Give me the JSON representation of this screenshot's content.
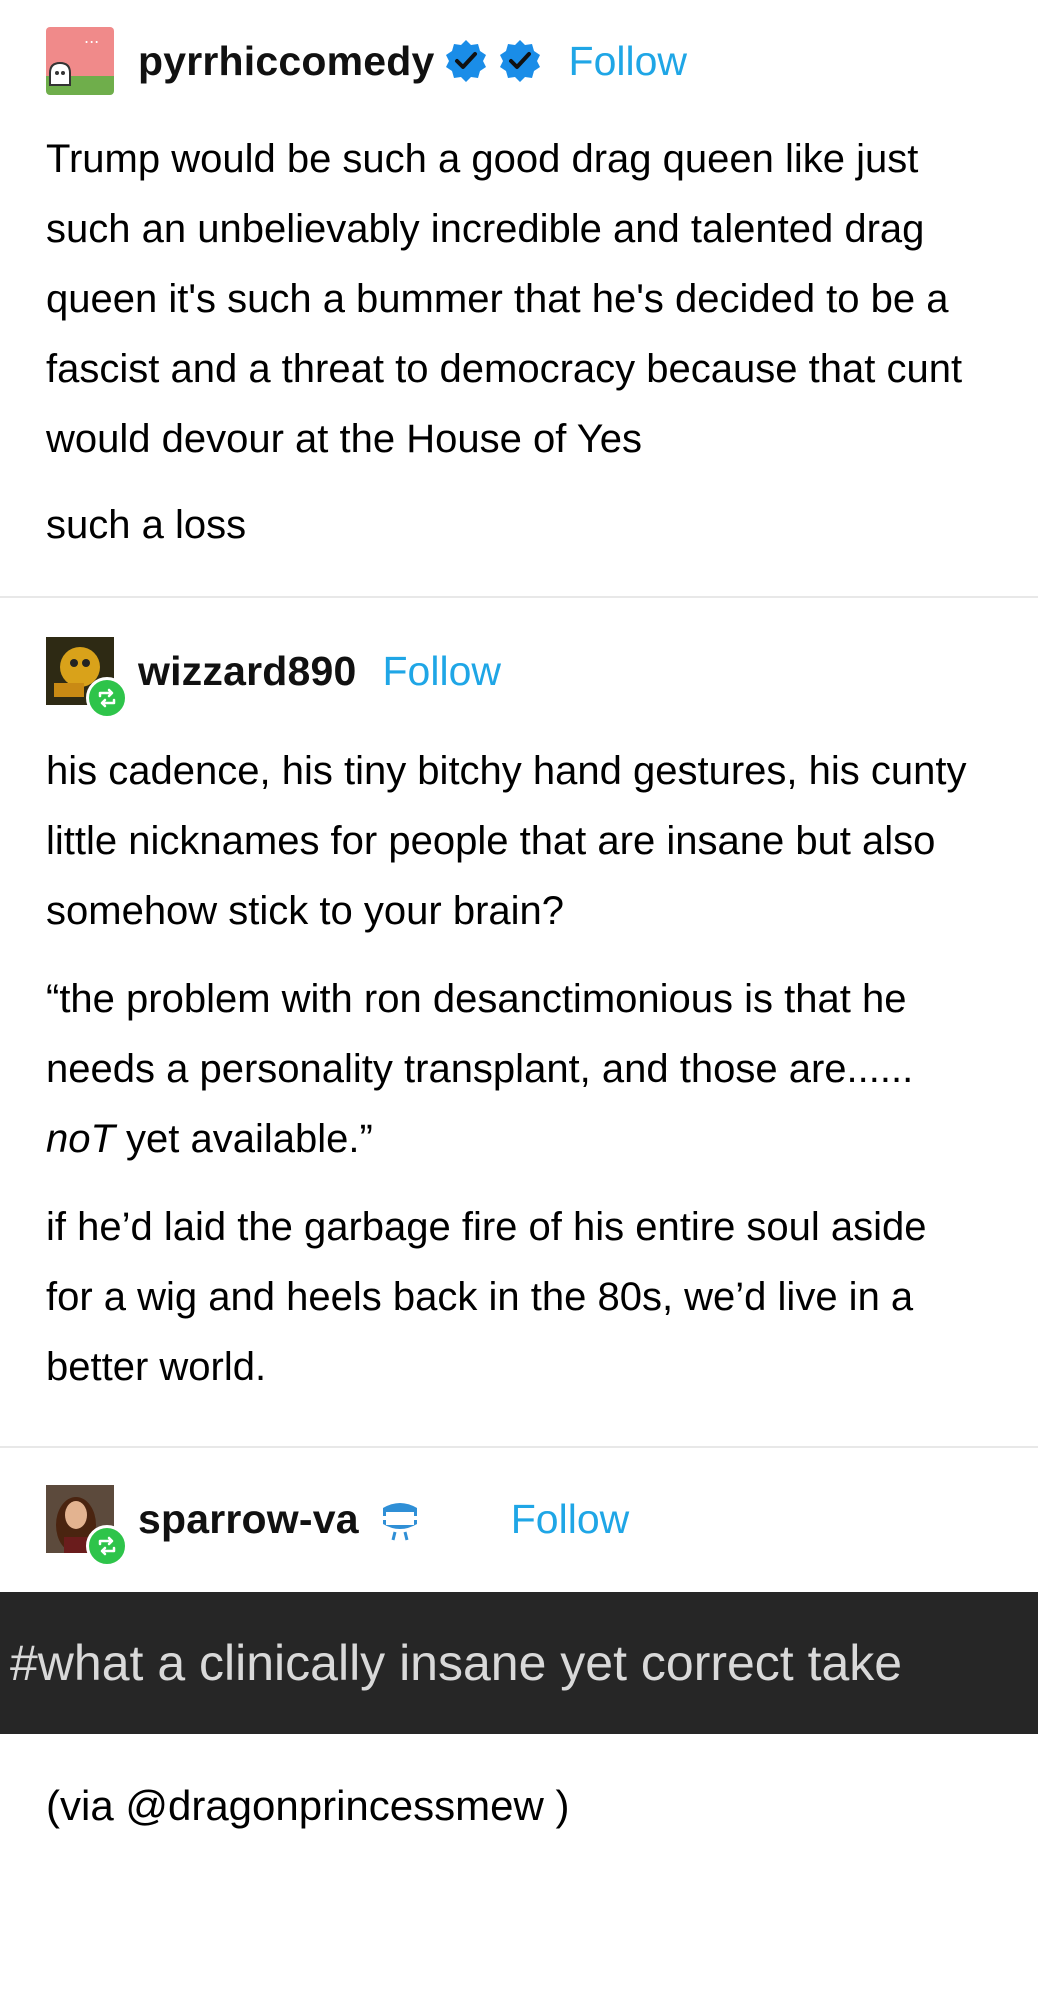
{
  "posts": [
    {
      "username": "pyrrhiccomedy",
      "follow": "Follow",
      "paragraphs": [
        "Trump would be such a good drag queen like just such an unbelievably incredible and talented drag queen it's such a bummer that he's decided to be a fascist and a threat to democracy because that cunt would devour at the House of Yes",
        "such a loss"
      ]
    },
    {
      "username": "wizzard890",
      "follow": "Follow",
      "p1": "his cadence, his tiny bitchy hand gestures, his cunty little nicknames for people that are insane but also somehow stick to your brain?",
      "p2_start": "“the problem with ron desanctimonious is that he needs a personality transplant, and those are...... ",
      "p2_em": "noT",
      "p2_end": " yet available.”",
      "p3": "if he’d laid the garbage fire of his entire soul aside for a wig and heels back in the 80s, we’d live in a better world."
    },
    {
      "username": "sparrow-va",
      "follow": "Follow"
    }
  ],
  "tag": "#what a clinically insane yet correct take",
  "via": "(via @dragonprincessmew )",
  "colors": {
    "follow": "#1fa6e6",
    "verified": "#1a8de8",
    "reblog_badge": "#2ec44a",
    "tag_bar": "#262626"
  }
}
